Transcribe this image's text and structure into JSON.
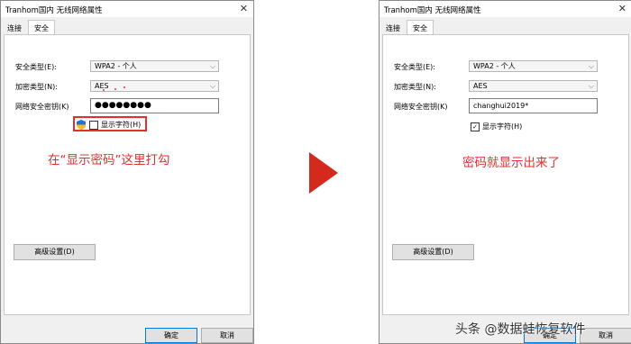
{
  "left_dialog": {
    "title": "Tranhom国内 无线网络属性",
    "tabs": [
      "连接",
      "安全"
    ],
    "security_type_label": "安全类型(E):",
    "security_type_value": "WPA2 - 个人",
    "encryption_type_label": "加密类型(N):",
    "encryption_type_value": "AES",
    "key_label": "网络安全密钥(K)",
    "key_value": "●●●●●●●●",
    "show_chars_label": "显示字符(H)",
    "show_chars_checked": false,
    "advanced_label": "高级设置(D)",
    "ok_label": "确定",
    "cancel_label": "取消",
    "annotation": "在“显示密码”这里打勾"
  },
  "right_dialog": {
    "title": "Tranhom国内 无线网络属性",
    "tabs": [
      "连接",
      "安全"
    ],
    "security_type_label": "安全类型(E):",
    "security_type_value": "WPA2 - 个人",
    "encryption_type_label": "加密类型(N):",
    "encryption_type_value": "AES",
    "key_label": "网络安全密钥(K)",
    "key_value": "changhui2019*",
    "show_chars_label": "显示字符(H)",
    "show_chars_checked": true,
    "advanced_label": "高级设置(D)",
    "ok_label": "确定",
    "cancel_label": "取消",
    "annotation": "密码就显示出来了"
  },
  "watermark": "头条 @数据蛙恢复软件",
  "colors": {
    "annotation_red": "#e03030",
    "arrow_red": "#d42a1e",
    "dialog_bg": "#f0f0f0"
  }
}
